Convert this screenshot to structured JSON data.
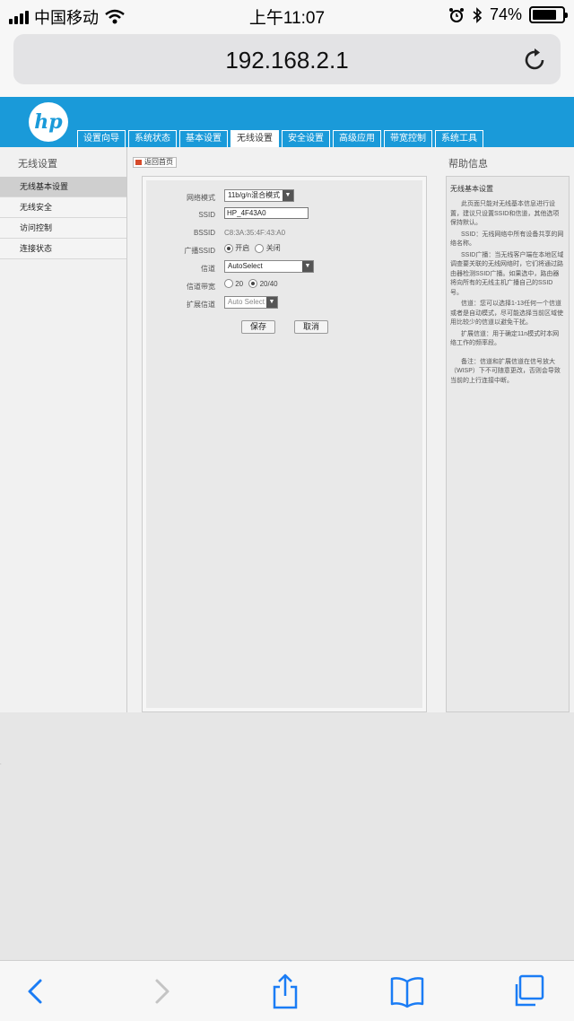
{
  "status_bar": {
    "carrier": "中国移动",
    "time": "上午11:07",
    "battery": "74%"
  },
  "browser": {
    "url": "192.168.2.1"
  },
  "router": {
    "logo": "hp",
    "tabs": [
      "设置向导",
      "系统状态",
      "基本设置",
      "无线设置",
      "安全设置",
      "高级应用",
      "带宽控制",
      "系统工具"
    ],
    "active_tab": "无线设置",
    "sidebar": {
      "title": "无线设置",
      "items": [
        "无线基本设置",
        "无线安全",
        "访问控制",
        "连接状态"
      ]
    },
    "back_home": "返回首页",
    "form": {
      "mode_label": "网络模式",
      "mode_value": "11b/g/n混合模式",
      "ssid_label": "SSID",
      "ssid_value": "HP_4F43A0",
      "bssid_label": "BSSID",
      "bssid_value": "C8:3A:35:4F:43:A0",
      "broadcast_label": "广播SSID",
      "broadcast_on": "开启",
      "broadcast_off": "关闭",
      "channel_label": "信道",
      "channel_value": "AutoSelect",
      "bandwidth_label": "信道带宽",
      "bw_20": "20",
      "bw_2040": "20/40",
      "ext_channel_label": "扩展信道",
      "ext_channel_value": "Auto Select",
      "save": "保存",
      "cancel": "取消"
    },
    "help": {
      "title": "帮助信息",
      "subtitle": "无线基本设置",
      "p1": "此页面只能对无线基本信息进行设置，建议只设置SSID和信道，其他选项保持默认。",
      "p2": "SSID：无线网络中所有设备共享的网络名称。",
      "p3": "SSID广播：当无线客户端在本地区域调查要关联的无线网络时，它们将通过路由器检测SSID广播。如果选中，路由器将向所有的无线主机广播自己的SSID号。",
      "p4": "信道：您可以选择1-13任何一个信道或者是自动模式，尽可能选择当前区域使用比较少的信道以避免干扰。",
      "p5": "扩展信道：用于确定11n模式时本网络工作的频率段。",
      "p6": "备注：信道和扩展信道在信号放大（WISP）下不可随意更改，否则会导致当前的上行连接中断。"
    }
  }
}
